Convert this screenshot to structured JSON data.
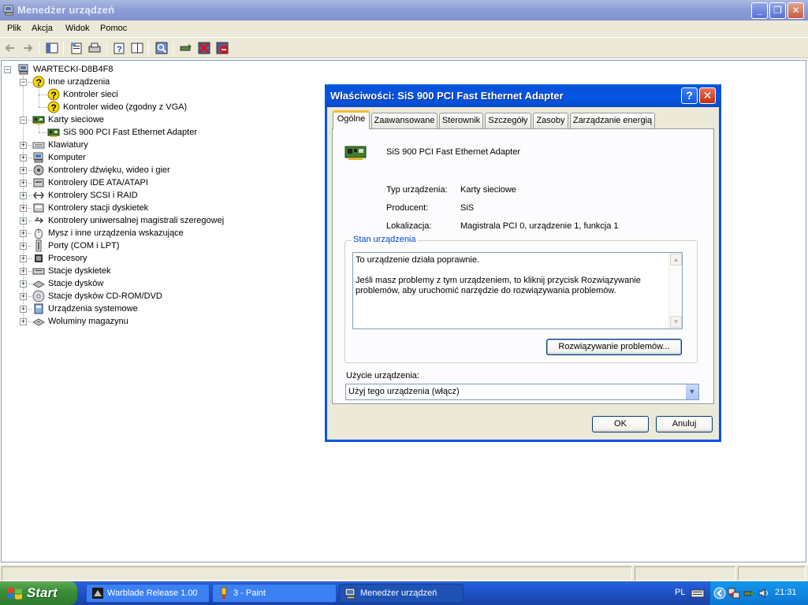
{
  "window": {
    "title": "Menedżer urządzeń",
    "menu": [
      "Plik",
      "Akcja",
      "Widok",
      "Pomoc"
    ],
    "toolbar_icons": [
      "back-arrow-icon",
      "forward-arrow-icon",
      "show-hide-console-tree-icon",
      "properties-icon",
      "print-icon",
      "help-icon",
      "show-hide-action-pane-icon",
      "scan-hardware-changes-icon",
      "update-driver-icon",
      "uninstall-icon",
      "disable-device-icon"
    ]
  },
  "tree": {
    "root": "WARTECKI-D8B4F8",
    "items": [
      {
        "label": "Inne urządzenia",
        "level": 1,
        "expanded": true,
        "icon": "unknown-device-icon"
      },
      {
        "label": "Kontroler sieci",
        "level": 2,
        "icon": "unknown-device-icon"
      },
      {
        "label": "Kontroler wideo (zgodny z VGA)",
        "level": 2,
        "icon": "unknown-device-icon"
      },
      {
        "label": "Karty sieciowe",
        "level": 1,
        "expanded": true,
        "icon": "network-card-icon"
      },
      {
        "label": "SiS 900 PCI Fast Ethernet Adapter",
        "level": 2,
        "icon": "network-card-icon"
      },
      {
        "label": "Klawiatury",
        "level": 1,
        "expanded": false,
        "icon": "keyboard-icon"
      },
      {
        "label": "Komputer",
        "level": 1,
        "expanded": false,
        "icon": "computer-icon"
      },
      {
        "label": "Kontrolery dźwięku, wideo i gier",
        "level": 1,
        "expanded": false,
        "icon": "sound-icon"
      },
      {
        "label": "Kontrolery IDE ATA/ATAPI",
        "level": 1,
        "expanded": false,
        "icon": "ide-icon"
      },
      {
        "label": "Kontrolery SCSI i RAID",
        "level": 1,
        "expanded": false,
        "icon": "scsi-icon"
      },
      {
        "label": "Kontrolery stacji dyskietek",
        "level": 1,
        "expanded": false,
        "icon": "floppy-controller-icon"
      },
      {
        "label": "Kontrolery uniwersalnej magistrali szeregowej",
        "level": 1,
        "expanded": false,
        "icon": "usb-icon"
      },
      {
        "label": "Mysz i inne urządzenia wskazujące",
        "level": 1,
        "expanded": false,
        "icon": "mouse-icon"
      },
      {
        "label": "Porty (COM i LPT)",
        "level": 1,
        "expanded": false,
        "icon": "port-icon"
      },
      {
        "label": "Procesory",
        "level": 1,
        "expanded": false,
        "icon": "processor-icon"
      },
      {
        "label": "Stacje dyskietek",
        "level": 1,
        "expanded": false,
        "icon": "floppy-drive-icon"
      },
      {
        "label": "Stacje dysków",
        "level": 1,
        "expanded": false,
        "icon": "disk-drive-icon"
      },
      {
        "label": "Stacje dysków CD-ROM/DVD",
        "level": 1,
        "expanded": false,
        "icon": "cdrom-icon"
      },
      {
        "label": "Urządzenia systemowe",
        "level": 1,
        "expanded": false,
        "icon": "system-device-icon"
      },
      {
        "label": "Woluminy magazynu",
        "level": 1,
        "expanded": false,
        "icon": "storage-volume-icon"
      }
    ]
  },
  "dialog": {
    "title": "Właściwości: SiS 900 PCI Fast Ethernet Adapter",
    "tabs": [
      "Ogólne",
      "Zaawansowane",
      "Sterownik",
      "Szczegóły",
      "Zasoby",
      "Zarządzanie energią"
    ],
    "device_name": "SiS 900 PCI Fast Ethernet Adapter",
    "props": [
      {
        "label": "Typ urządzenia:",
        "value": "Karty sieciowe"
      },
      {
        "label": "Producent:",
        "value": "SiS"
      },
      {
        "label": "Lokalizacja:",
        "value": "Magistrala PCI 0, urządzenie 1, funkcja 1"
      }
    ],
    "status_legend": "Stan urządzenia",
    "status_line1": "To urządzenie działa poprawnie.",
    "status_line2": "Jeśli masz problemy z tym urządzeniem, to kliknij przycisk Rozwiązywanie problemów, aby uruchomić narzędzie do rozwiązywania problemów.",
    "troubleshoot_label": "Rozwiązywanie problemów...",
    "usage_label": "Użycie urządzenia:",
    "usage_value": "Użyj tego urządzenia (włącz)",
    "ok_label": "OK",
    "cancel_label": "Anuluj"
  },
  "taskbar": {
    "start_label": "Start",
    "tasks": [
      {
        "label": "Warblade Release 1.00",
        "active": false
      },
      {
        "label": "3 - Paint",
        "active": false
      },
      {
        "label": "Menedżer urządzeń",
        "active": true
      }
    ],
    "language": "PL",
    "clock": "21:31"
  }
}
